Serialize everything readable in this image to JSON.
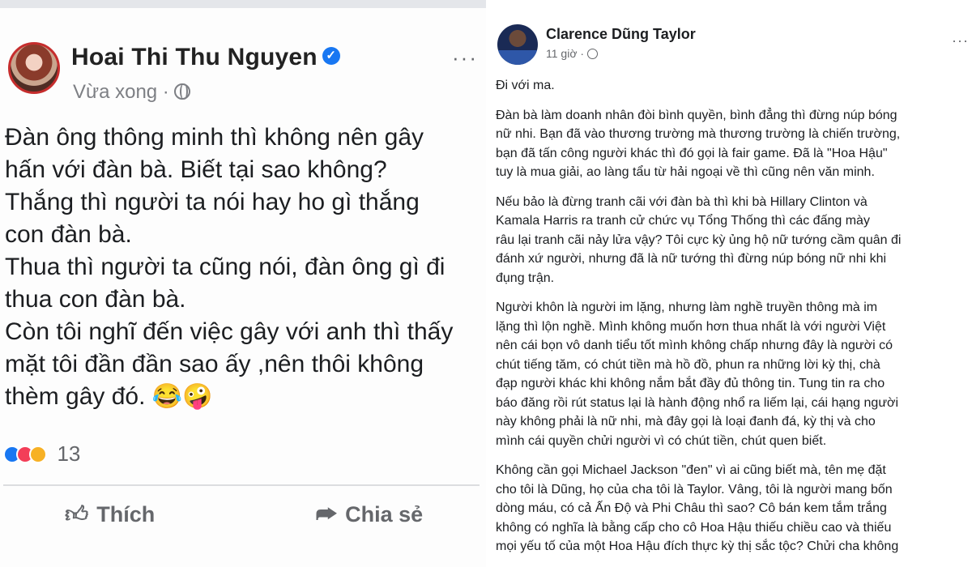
{
  "left_post": {
    "author": "Hoai Thi Thu Nguyen",
    "verified_icon": "verified-badge-icon",
    "timestamp": "Vừa xong",
    "more_label": "···",
    "body_lines": [
      "Đàn ông thông minh thì không nên gây",
      "hấn với đàn bà. Biết tại sao không?",
      "Thắng thì người ta nói hay ho gì thắng",
      "con đàn bà.",
      "Thua thì người ta cũng nói, đàn ông gì đi",
      "thua con đàn bà.",
      "Còn tôi nghĩ đến việc gây với anh thì thấy",
      "mặt tôi đần đần sao ấy ,nên thôi không",
      "thèm gây đó. 😂🤪"
    ],
    "reaction_count": "13",
    "reaction_icons": [
      "like-reaction-icon",
      "love-reaction-icon",
      "haha-reaction-icon"
    ],
    "like_label": "Thích",
    "share_label": "Chia sẻ"
  },
  "right_post": {
    "author": "Clarence Dũng Taylor",
    "timestamp": "11 giờ ·",
    "more_label": "···",
    "paragraphs": [
      [
        "Đi với ma."
      ],
      [
        "Đàn bà làm doanh nhân đòi bình quyền, bình đẳng thì đừng núp bóng",
        "nữ nhi. Bạn đã vào thương trường mà thương trường là chiến trường,",
        "bạn đã tấn công người khác thì đó gọi là fair game. Đã là \"Hoa Hậu\"",
        "tuy là mua giải, ao làng tẩu từ hải ngoại về thì cũng nên văn minh."
      ],
      [
        "Nếu bảo là đừng tranh cãi với đàn bà thì khi bà Hillary Clinton và",
        "Kamala Harris ra tranh cử chức vụ Tổng Thống thì các đấng mày",
        "râu lại tranh cãi nảy lửa vậy? Tôi cực kỳ ủng hộ nữ tướng cầm quân đi",
        "đánh xứ người, nhưng đã là nữ tướng thì đừng núp bóng nữ nhi khi",
        "đụng trận."
      ],
      [
        "Người khôn là người im lặng, nhưng làm nghề truyền thông mà im",
        "lặng thì lộn nghề. Mình không muốn hơn thua nhất là với người Việt",
        "nên cái bọn vô danh tiểu tốt mình không chấp nhưng đây là người có",
        "chút tiếng tăm, có chút tiền mà hồ đồ, phun ra những lời kỳ thị, chà",
        "đạp người khác khi không nắm bắt đầy đủ thông tin. Tung tin ra cho",
        "báo đăng rồi rút status lại là hành động nhổ ra liếm lại, cái hạng người",
        "này không phải là nữ nhi, mà đây gọi là loại đanh đá, kỳ thị và cho",
        "mình cái quyền chửi người vì có chút tiền, chút quen biết."
      ],
      [
        "Không cần gọi Michael Jackson \"đen\" vì ai cũng biết mà, tên mẹ đặt",
        "cho tôi là Dũng, họ của cha tôi là Taylor. Vâng, tôi là người mang bốn",
        "dòng máu, có cả Ấn Độ và Phi Châu thì sao? Cô bán kem tắm trắng",
        "không có nghĩa là bằng cấp cho cô Hoa Hậu thiếu chiều cao và thiếu",
        "mọi yếu tố của một Hoa Hậu đích thực kỳ thị sắc tộc? Chửi cha không"
      ]
    ]
  }
}
